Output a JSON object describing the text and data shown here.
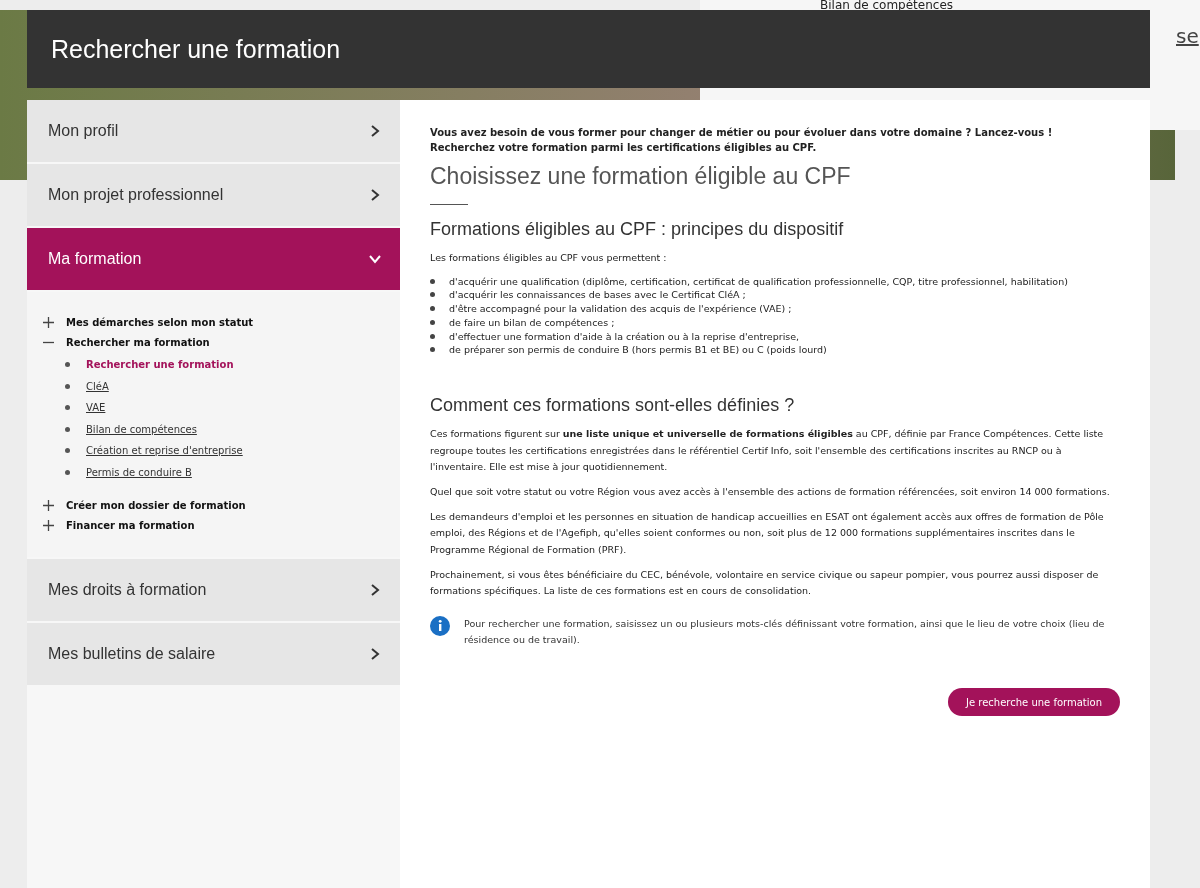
{
  "background": {
    "link": "Bilan de compétences",
    "edge_text": "se"
  },
  "dialog": {
    "title": "Rechercher une formation"
  },
  "sidebar": {
    "items": [
      {
        "label": "Mon profil",
        "selected": false,
        "expanded": false
      },
      {
        "label": "Mon projet professionnel",
        "selected": false,
        "expanded": false
      },
      {
        "label": "Ma formation",
        "selected": true,
        "expanded": true,
        "children": [
          {
            "label": "Mes démarches selon mon statut",
            "expanded": false
          },
          {
            "label": "Rechercher ma formation",
            "expanded": true,
            "children": [
              {
                "label": "Rechercher une formation",
                "selected": true
              },
              {
                "label": "CléA",
                "selected": false
              },
              {
                "label": "VAE",
                "selected": false
              },
              {
                "label": "Bilan de compétences",
                "selected": false
              },
              {
                "label": "Création et reprise d'entreprise",
                "selected": false
              },
              {
                "label": "Permis de conduire B",
                "selected": false
              }
            ]
          },
          {
            "label": "Créer mon dossier de formation",
            "expanded": false
          },
          {
            "label": "Financer ma formation",
            "expanded": false
          }
        ]
      },
      {
        "label": "Mes droits à formation",
        "selected": false,
        "expanded": false
      },
      {
        "label": "Mes bulletins de salaire",
        "selected": false,
        "expanded": false
      }
    ]
  },
  "main": {
    "intro": "Vous avez besoin de vous former pour changer de métier ou pour évoluer dans votre domaine ? Lancez-vous ! Recherchez votre formation parmi les certifications éligibles au CPF.",
    "title": "Choisissez une formation éligible au CPF",
    "section1": {
      "heading": "Formations éligibles au CPF : principes du dispositif",
      "lead": "Les formations éligibles au CPF vous permettent :",
      "bullets": [
        "d'acquérir une qualification (diplôme, certification, certificat de qualification professionnelle, CQP, titre professionnel, habilitation)",
        "d'acquérir les connaissances de bases avec le Certificat CléA ;",
        "d'être accompagné pour la validation des acquis de l'expérience (VAE) ;",
        "de faire un bilan de compétences ;",
        "d'effectuer une formation d'aide à la création ou à la reprise d'entreprise,",
        "de préparer son permis de conduire B (hors permis B1 et BE) ou C (poids lourd)"
      ]
    },
    "section2": {
      "heading": "Comment ces formations sont-elles définies ?",
      "paragraphs": [
        "Ces formations figurent sur **une liste unique et universelle de formations éligibles** au CPF, définie par France Compétences. Cette liste regroupe toutes les certifications enregistrées dans le référentiel Certif Info, soit l'ensemble des certifications inscrites au RNCP ou à l'inventaire. Elle est mise à jour quotidiennement.",
        "Quel que soit votre statut ou votre Région vous avez accès à l'ensemble des actions de formation référencées, soit environ 14 000 formations.",
        "Les demandeurs d'emploi et les personnes en situation de handicap accueillies en ESAT ont également accès aux offres de formation de Pôle emploi, des Régions et de l'Agefiph, qu'elles soient conformes ou non, soit plus de 12 000 formations supplémentaires inscrites dans le Programme Régional de Formation (PRF).",
        "Prochainement, si vous êtes bénéficiaire du CEC, bénévole, volontaire en service civique ou sapeur pompier, vous pourrez aussi disposer de formations spécifiques. La liste de ces formations est en cours de consolidation."
      ]
    },
    "info": "Pour rechercher une formation, saisissez un ou plusieurs mots-clés définissant votre formation, ainsi que le lieu de votre choix (lieu de résidence ou de travail).",
    "button": "Je recherche une formation"
  }
}
